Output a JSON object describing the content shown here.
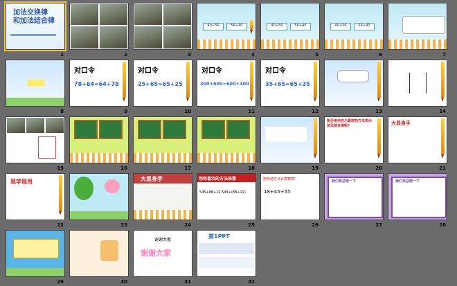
{
  "slides": [
    {
      "n": "1",
      "title": "加法交换律\n和加法结合律"
    },
    {
      "n": "2"
    },
    {
      "n": "3"
    },
    {
      "n": "4",
      "lines": [
        "40+56",
        "56+40"
      ]
    },
    {
      "n": "5",
      "lines": [
        "40+56",
        "56+40"
      ]
    },
    {
      "n": "6",
      "lines": [
        "40+56",
        "56+40"
      ]
    },
    {
      "n": "7"
    },
    {
      "n": "8"
    },
    {
      "n": "9",
      "title": "对口令",
      "expr": "78+64=64+78"
    },
    {
      "n": "10",
      "title": "对口令",
      "expr": "25+65=65+25"
    },
    {
      "n": "11",
      "title": "对口令",
      "expr": "300+600=600+300"
    },
    {
      "n": "12",
      "title": "对口令",
      "expr": "35+65=65+35"
    },
    {
      "n": "13"
    },
    {
      "n": "14"
    },
    {
      "n": "15"
    },
    {
      "n": "16"
    },
    {
      "n": "17"
    },
    {
      "n": "18"
    },
    {
      "n": "19"
    },
    {
      "n": "20",
      "title": "能否用你自己喜欢的方法表示加法结合律呢?"
    },
    {
      "n": "21",
      "title": "大显身手"
    },
    {
      "n": "22",
      "title": "现学现用"
    },
    {
      "n": "23"
    },
    {
      "n": "24",
      "title": "大显身手"
    },
    {
      "n": "25",
      "title": "用你喜欢的方法来算",
      "expr": "545+88+12    545+(88+12)"
    },
    {
      "n": "26",
      "title": "用简便方法计算算算!",
      "expr": "18+45+55"
    },
    {
      "n": "27",
      "title": "我们来总结一下"
    },
    {
      "n": "28",
      "title": "我们来总结一下"
    },
    {
      "n": "29"
    },
    {
      "n": "30"
    },
    {
      "n": "31",
      "title": "谢谢大家"
    },
    {
      "n": "32",
      "title": "第1PPT"
    }
  ]
}
